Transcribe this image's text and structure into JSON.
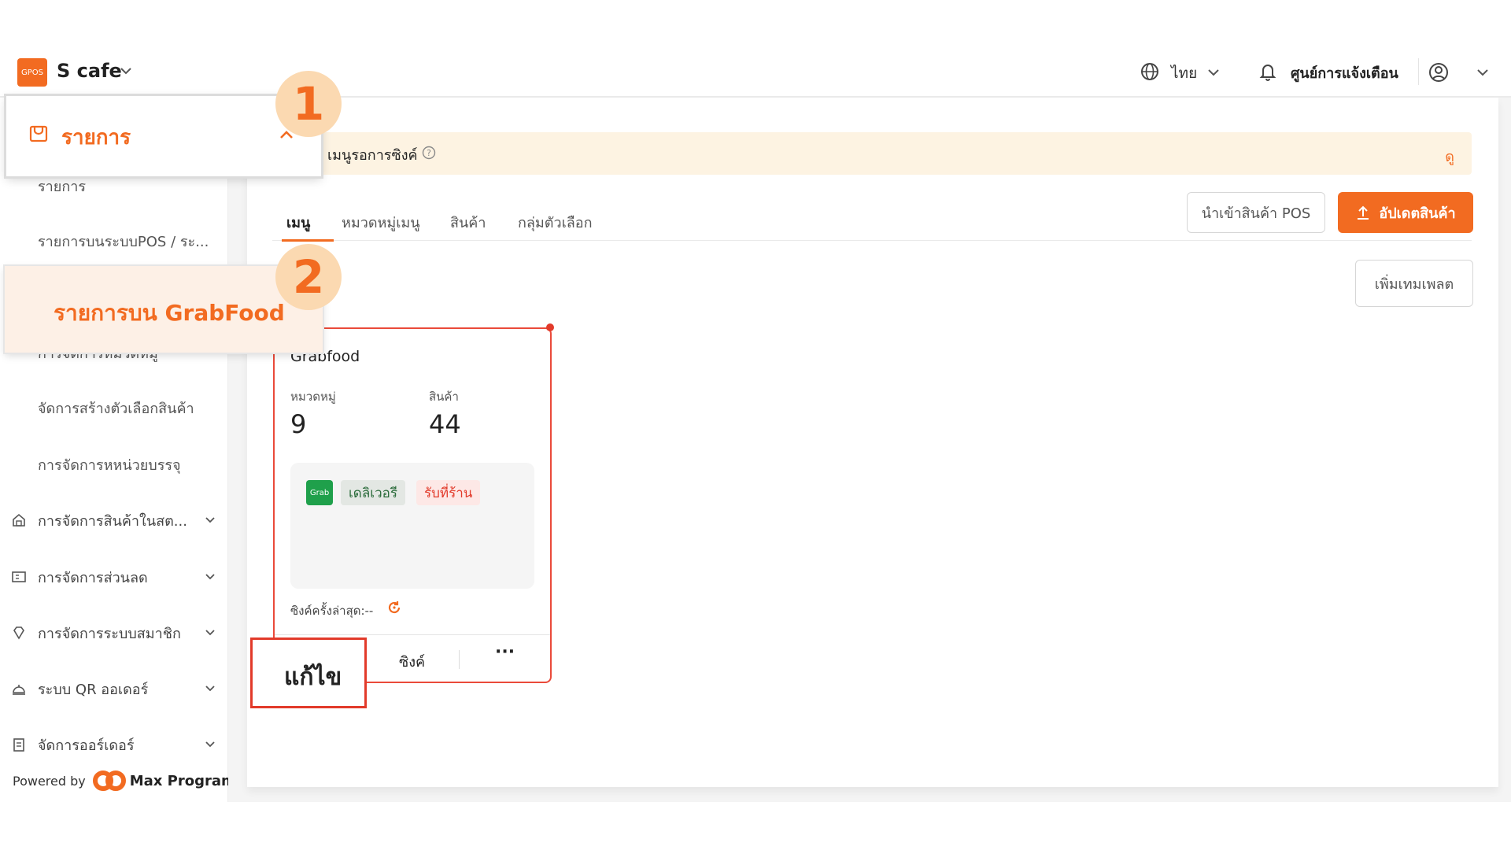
{
  "header": {
    "logo_text": "GPOS",
    "shop_name": "S cafe",
    "language": "ไทย",
    "notification_center": "ศูนย์การแจ้งเตือน"
  },
  "sidebar": {
    "highlighted_menu": "รายการ",
    "sub_items": [
      "รายการ",
      "รายการบนระบบPOS / ระ...",
      "การจัดการหมวดหมู่",
      "จัดการสร้างตัวเลือกสินค้า",
      "การจัดการหหน่วยบรรจุ"
    ],
    "highlighted_sub_item": "รายการบน GrabFood",
    "groups": [
      "การจัดการสินค้าในสต...",
      "การจัดการส่วนลด",
      "การจัดการระบบสมาชิก",
      "ระบบ QR ออเดอร์",
      "จัดการออร์เดอร์"
    ],
    "powered_by": "Powered by",
    "powered_name": "Max Program"
  },
  "banner": {
    "text": "เมนูรอการซิงค์",
    "link": "ดู"
  },
  "tabs": [
    "เมนู",
    "หมวดหมู่เมนู",
    "สินค้า",
    "กลุ่มตัวเลือก"
  ],
  "active_tab": 0,
  "toolbar": {
    "import_label": "นำเข้าสินค้า POS",
    "update_label": "อัปเดตสินค้า",
    "template_label": "เพิ่มเทมเพลต"
  },
  "card": {
    "title": "Grabfood",
    "category_label": "หมวดหมู่",
    "category_count": "9",
    "product_label": "สินค้า",
    "product_count": "44",
    "grab_logo": "Grab",
    "tag_delivery": "เดลิเวอรี",
    "tag_pickup": "รับที่ร้าน",
    "last_sync": "ซิงค์ครั้งล่าสุด:--",
    "edit_label": "แก้ไข",
    "sync_label": "ซิงค์",
    "more_label": "···"
  },
  "steps": [
    "1",
    "2"
  ],
  "colors": {
    "brand": "#f26b21",
    "grab_green": "#1fa04b",
    "highlight_red": "#e23a2a",
    "banner_bg": "#fdf3e2"
  }
}
